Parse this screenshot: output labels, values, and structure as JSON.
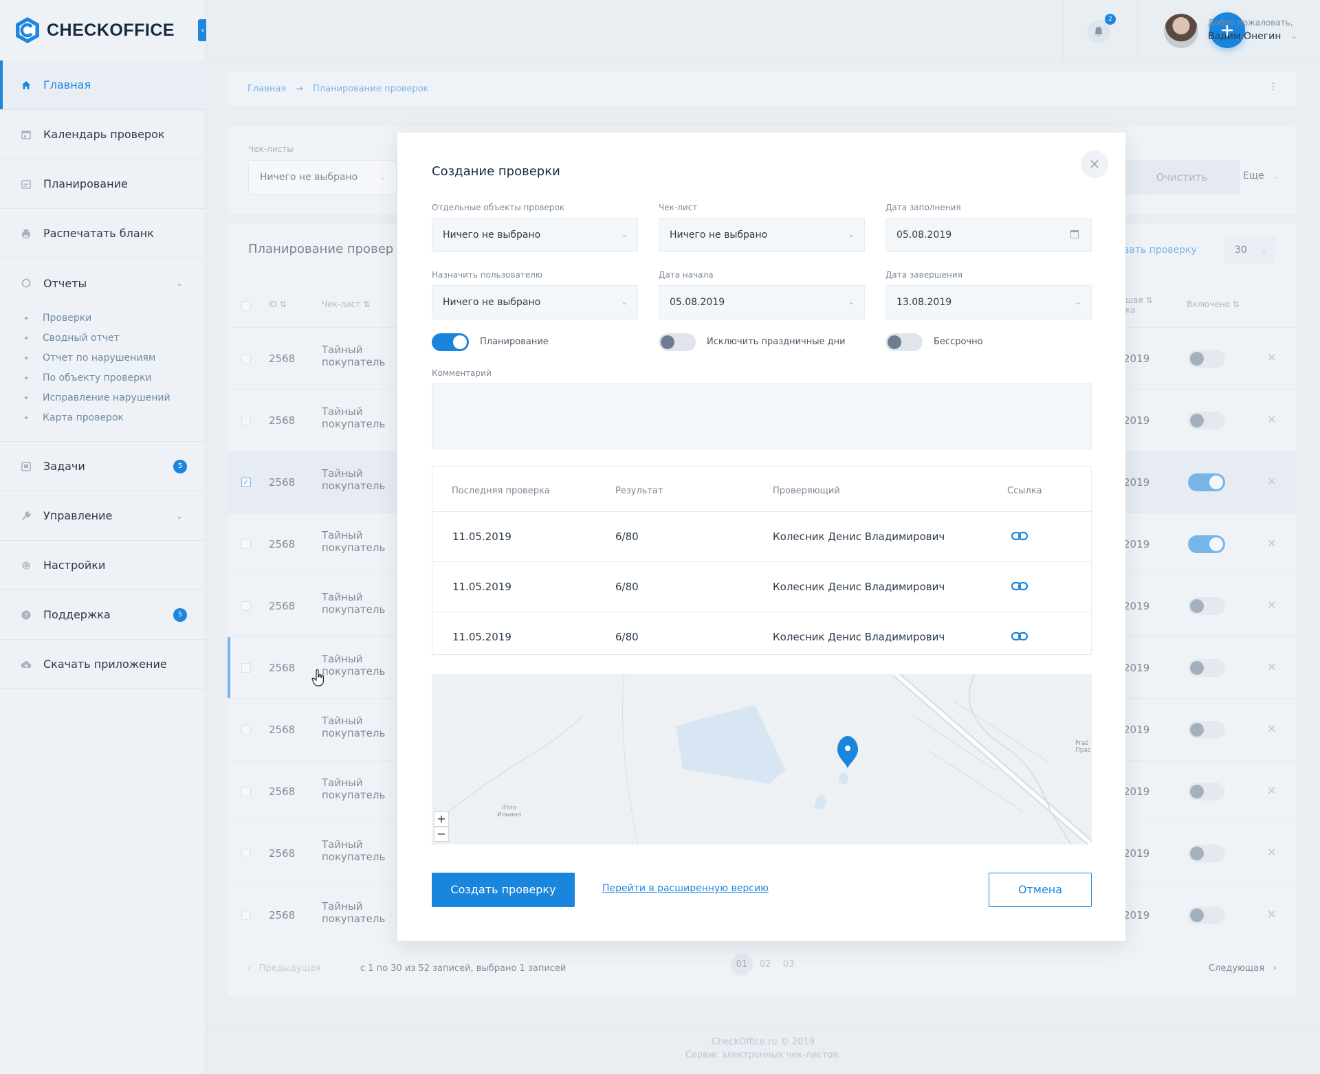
{
  "brand": {
    "name": "CHECKOFFICE"
  },
  "colors": {
    "accent": "#1a85dd",
    "sidebar_bg": "#eef2f6",
    "page_bg": "#e9eef3"
  },
  "sidebar": {
    "items": [
      {
        "label": "Главная",
        "icon": "home-icon",
        "active": true
      },
      {
        "label": "Календарь проверок",
        "icon": "calendar-icon"
      },
      {
        "label": "Планирование",
        "icon": "planning-icon"
      },
      {
        "label": "Распечатать бланк",
        "icon": "print-icon"
      }
    ],
    "reports": {
      "label": "Отчеты",
      "icon": "reports-icon",
      "children": [
        "Проверки",
        "Сводный отчет",
        "Отчет по нарушениям",
        "По объекту проверки",
        "Исправление нарушений",
        "Карта проверок"
      ]
    },
    "items2": [
      {
        "label": "Задачи",
        "icon": "tasks-icon",
        "badge": "5"
      },
      {
        "label": "Управление",
        "icon": "wrench-icon"
      },
      {
        "label": "Настройки",
        "icon": "gear-icon"
      },
      {
        "label": "Поддержка",
        "icon": "help-icon",
        "badge": "5"
      },
      {
        "label": "Скачать приложение",
        "icon": "cloud-download-icon"
      }
    ]
  },
  "header": {
    "notifications": "2",
    "welcome": "Добро пожаловать,",
    "username": "Вадим Онегин"
  },
  "breadcrumb": [
    "Главная",
    "Планирование проверок"
  ],
  "filters": {
    "checklists_label": "Чек-листы",
    "checklists_value": "Ничего не выбрано",
    "clear": "Очистить",
    "more": "Еще"
  },
  "table": {
    "title": "Планирование провер",
    "add_link": "вать проверку",
    "per_page": "30",
    "columns": {
      "id": "ID",
      "checklist": "Чек-лист",
      "last": "шая",
      "last2": "ка",
      "enabled": "Включено"
    },
    "rows": [
      {
        "id": "2568",
        "name": "Тайный покупатель",
        "date": "2019",
        "enabled": false
      },
      {
        "id": "2568",
        "name": "Тайный покупатель",
        "date": "2019",
        "enabled": false
      },
      {
        "id": "2568",
        "name": "Тайный покупатель",
        "date": "2019",
        "enabled": true,
        "selected": true
      },
      {
        "id": "2568",
        "name": "Тайный покупатель",
        "date": "2019",
        "enabled": true
      },
      {
        "id": "2568",
        "name": "Тайный покупатель",
        "date": "2019",
        "enabled": false
      },
      {
        "id": "2568",
        "name": "Тайный покупатель",
        "date": "2019",
        "enabled": false,
        "hover": true
      },
      {
        "id": "2568",
        "name": "Тайный покупатель",
        "date": "2019",
        "enabled": false
      },
      {
        "id": "2568",
        "name": "Тайный покупатель",
        "date": "2019",
        "enabled": false
      },
      {
        "id": "2568",
        "name": "Тайный покупатель",
        "date": "2019",
        "enabled": false
      },
      {
        "id": "2568",
        "name": "Тайный покупатель",
        "date": "2019",
        "enabled": false
      }
    ]
  },
  "pagination": {
    "prev": "Предыдущая",
    "info": "с 1 по 30 из 52 записей, выбрано 1 записей",
    "pages": [
      "01",
      "02",
      "03"
    ],
    "next": "Следующая"
  },
  "footer": {
    "line1": "CheckOffice.ru © 2019",
    "line2": "Сервис электронных чек-листов."
  },
  "modal": {
    "title": "Создание проверки",
    "fields": {
      "objects_label": "Отдельные объекты проверок",
      "objects_value": "Ничего не выбрано",
      "checklist_label": "Чек-лист",
      "checklist_value": "Ничего не выбрано",
      "fill_date_label": "Дата заполнения",
      "fill_date_value": "05.08.2019",
      "assign_label": "Назначить пользователю",
      "assign_value": "Ничего не выбрано",
      "start_label": "Дата начала",
      "start_value": "05.08.2019",
      "end_label": "Дата завершения",
      "end_value": "13.08.2019"
    },
    "toggles": {
      "planning": "Планирование",
      "exclude_holidays": "Исключить праздничные дни",
      "indefinite": "Бессрочно"
    },
    "comment_label": "Комментарий",
    "history": {
      "columns": [
        "Последняя проверка",
        "Результат",
        "Проверяющий",
        "Ссылка"
      ],
      "rows": [
        {
          "date": "11.05.2019",
          "result": "6/80",
          "inspector": "Колесник Денис Владимирович"
        },
        {
          "date": "11.05.2019",
          "result": "6/80",
          "inspector": "Колесник Денис Владимирович"
        },
        {
          "date": "11.05.2019",
          "result": "6/80",
          "inspector": "Колесник Денис Владимирович"
        }
      ]
    },
    "map": {
      "place1": "Il'ino",
      "place2": "Ильино",
      "place3": "Praś",
      "place4": "Прас"
    },
    "create": "Создать проверку",
    "extended": "Перейти в расширенную версию",
    "cancel": "Отмена"
  }
}
